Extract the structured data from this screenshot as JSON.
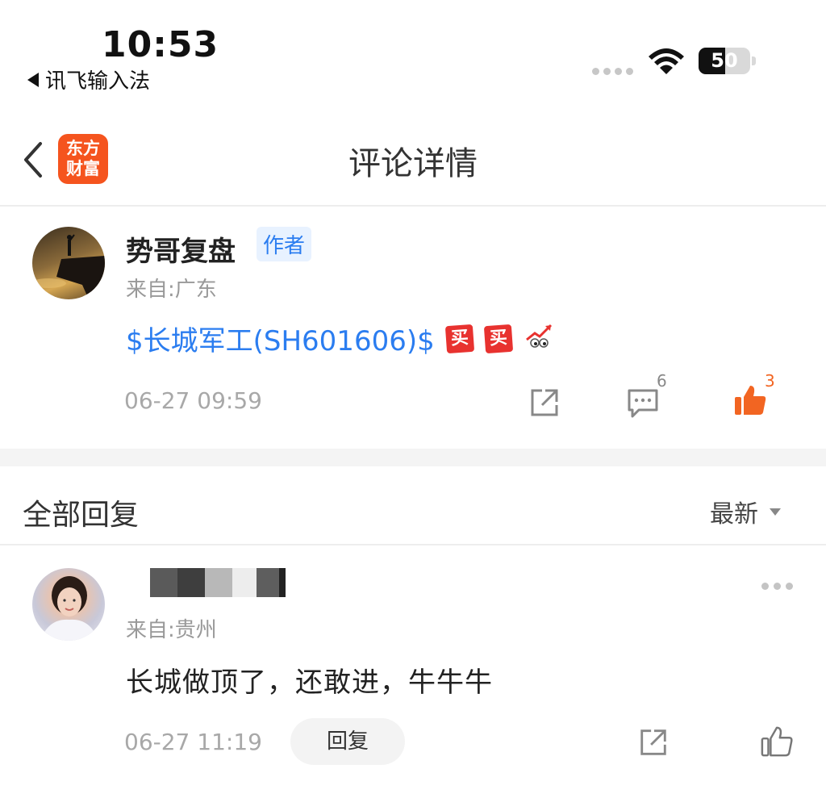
{
  "status_bar": {
    "time": "10:53",
    "back_app_label": "讯飞输入法",
    "battery_level": "50"
  },
  "nav": {
    "logo_line1": "东方",
    "logo_line2": "财富",
    "title": "评论详情"
  },
  "post": {
    "author_name": "势哥复盘",
    "author_badge": "作者",
    "location": "来自:广东",
    "stock_tag": "$长城军工(SH601606)$",
    "emoji_buy_1": "买",
    "emoji_buy_2": "买",
    "timestamp": "06-27 09:59",
    "comment_count": "6",
    "like_count": "3"
  },
  "replies_header": {
    "title": "全部回复",
    "sort_label": "最新"
  },
  "reply": {
    "location": "来自:贵州",
    "text": "长城做顶了，还敢进，牛牛牛",
    "timestamp": "06-27 11:19",
    "reply_button": "回复"
  },
  "colors": {
    "accent_blue": "#2b7df0",
    "brand_orange": "#f5541e",
    "like_orange": "#f26522"
  },
  "icons": [
    "chevron-left-icon",
    "share-icon",
    "comment-icon",
    "thumbs-up-icon",
    "more-icon",
    "wifi-icon"
  ]
}
